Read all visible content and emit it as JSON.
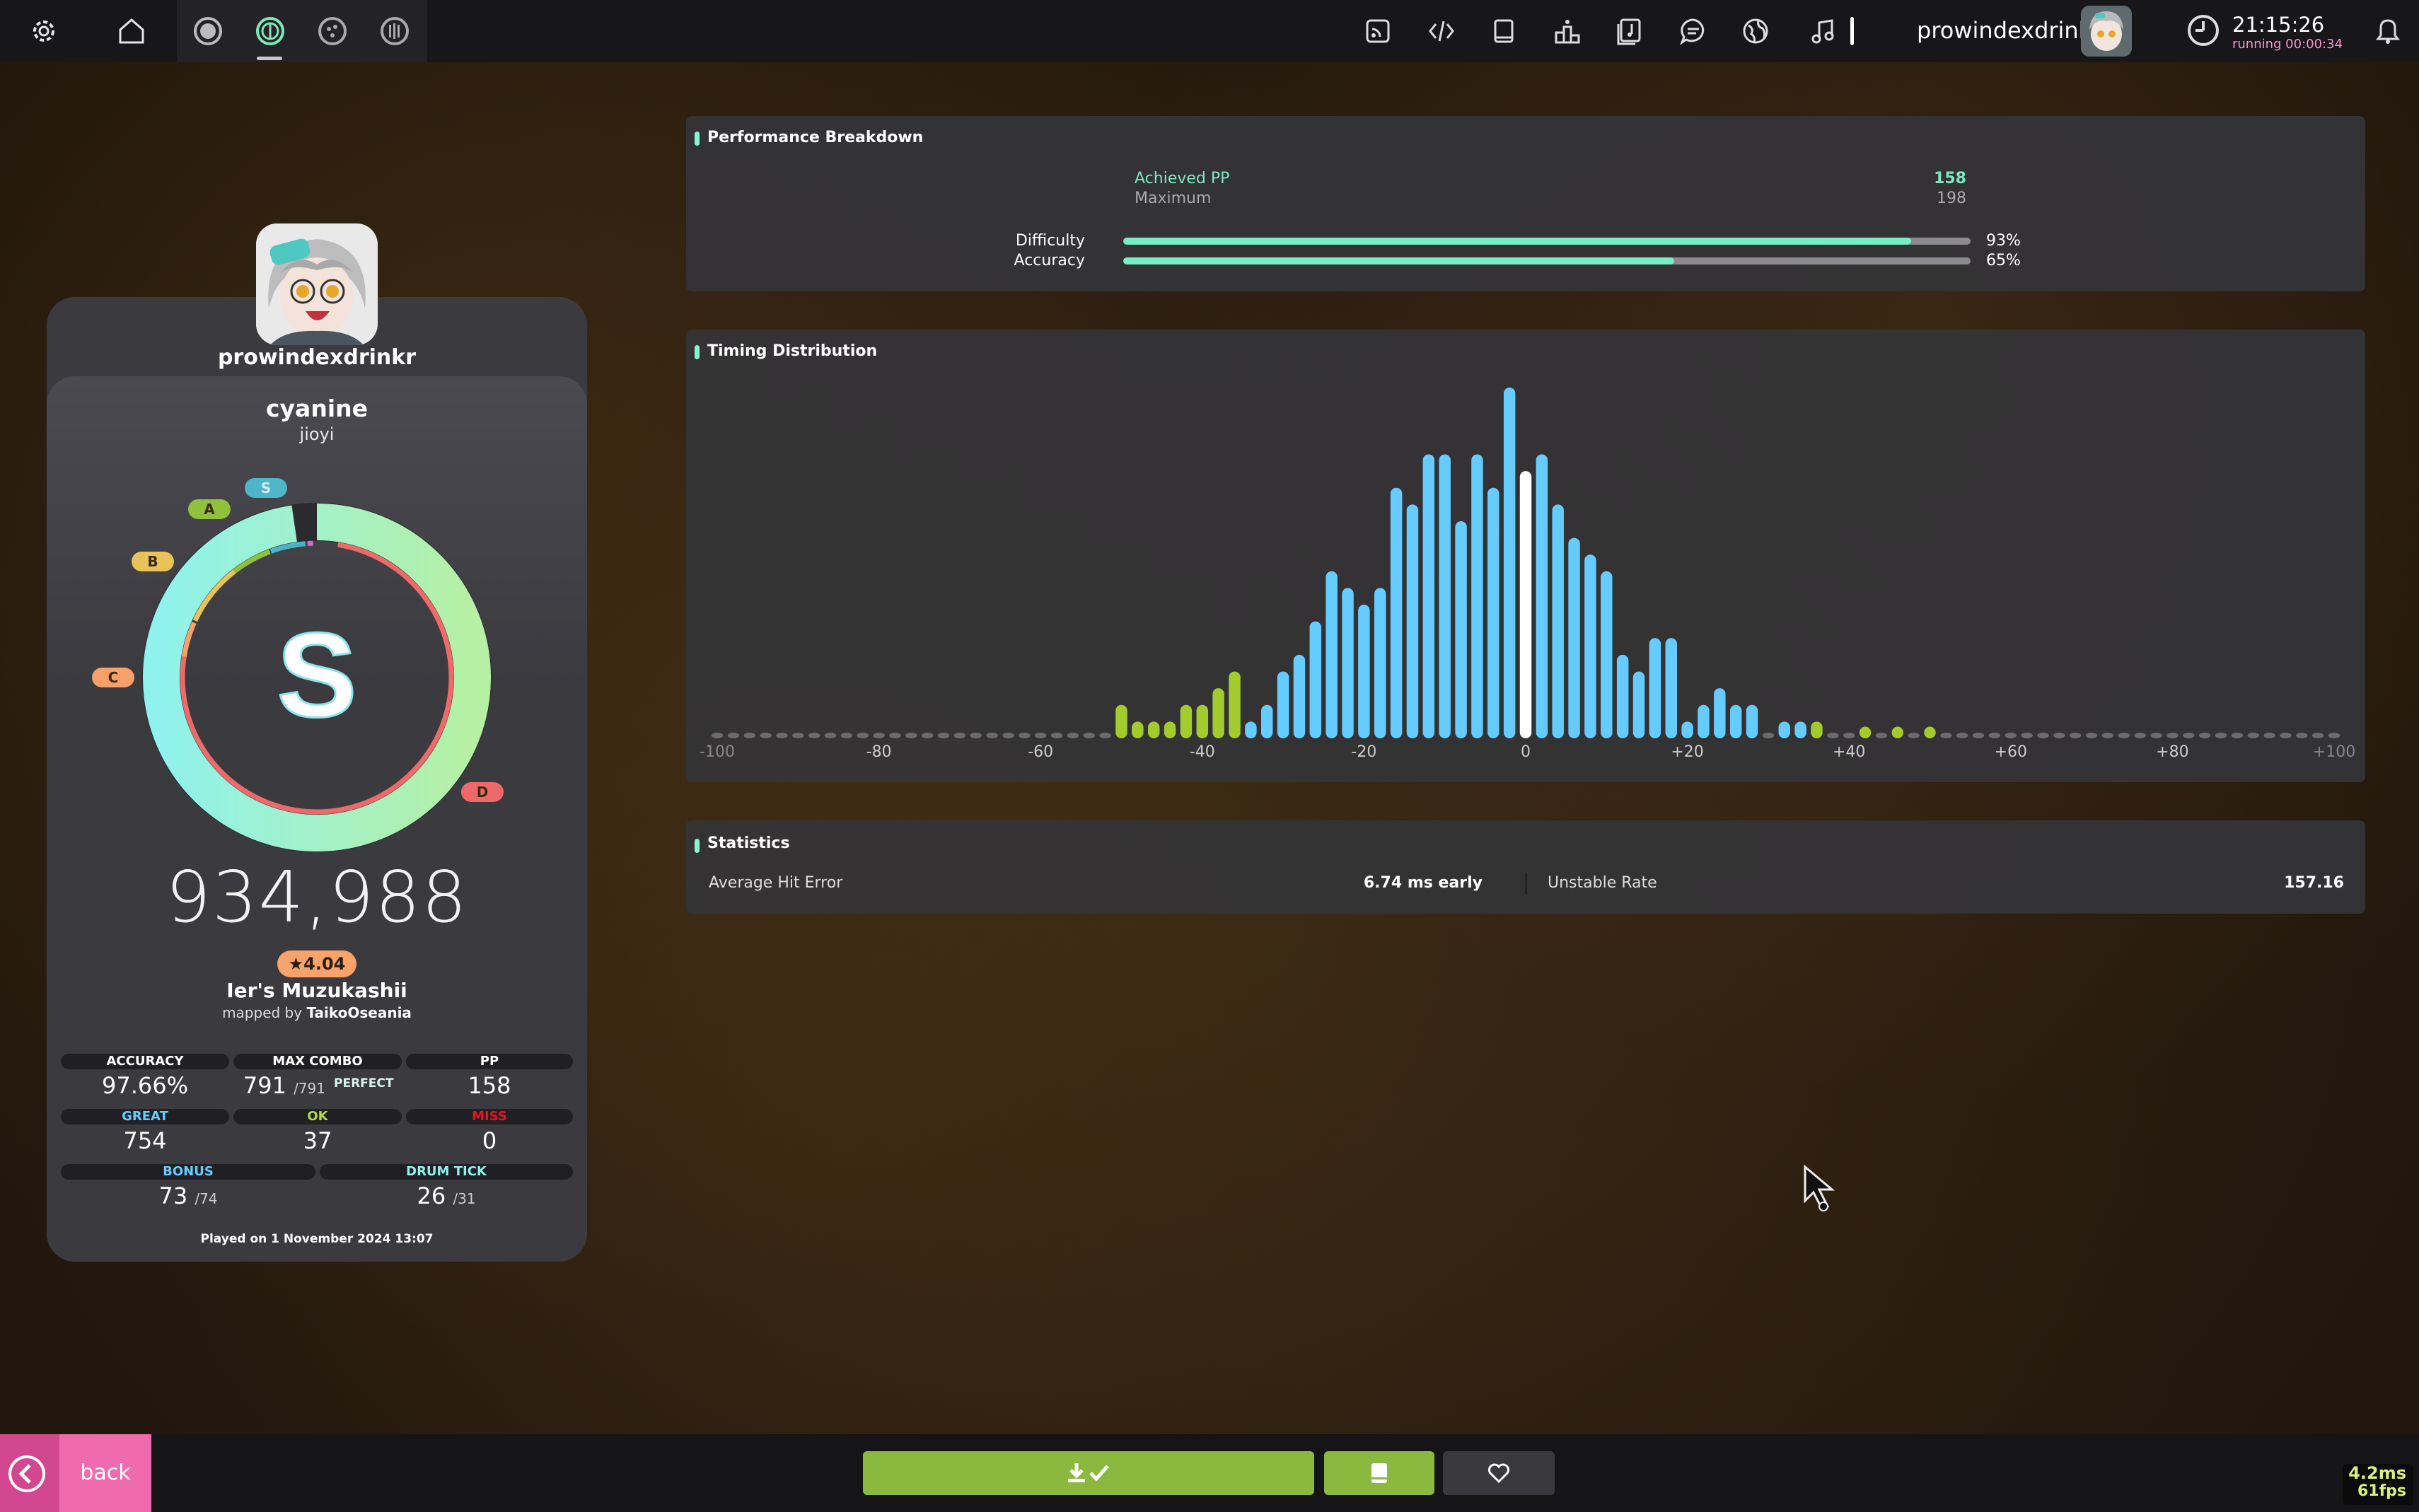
{
  "topbar": {
    "username": "prowindexdrinkr",
    "clock": "21:15:26",
    "running": "running 00:00:34",
    "icons": [
      "settings-icon",
      "home-icon",
      "osu-ruleset-icon",
      "taiko-ruleset-icon",
      "catch-ruleset-icon",
      "mania-ruleset-icon",
      "news-icon",
      "changelog-icon",
      "wiki-icon",
      "rankings-icon",
      "beatmap-listing-icon",
      "chat-icon",
      "dashboard-icon",
      "now-playing-icon",
      "notifications-icon"
    ]
  },
  "score_panel": {
    "player": "prowindexdrinkr",
    "beatmap_title": "cyanine",
    "beatmap_artist": "jioyi",
    "rank_labels": {
      "s": "S",
      "a": "A",
      "b": "B",
      "c": "C",
      "d": "D"
    },
    "grade": "S",
    "score": "934,988",
    "stars": "★4.04",
    "difficulty_name": "Ier's Muzukashii",
    "mapped_by": "mapped by",
    "mapper": "TaikoOseania",
    "accuracy_fraction": 0.9766,
    "stats": {
      "accuracy_label": "ACCURACY",
      "accuracy": "97.66%",
      "max_combo_label": "MAX COMBO",
      "max_combo": "791",
      "max_combo_total": "/791",
      "perfect": "PERFECT",
      "pp_label": "PP",
      "pp": "158",
      "great_label": "GREAT",
      "great": "754",
      "ok_label": "OK",
      "ok": "37",
      "miss_label": "MISS",
      "miss": "0",
      "bonus_label": "BONUS",
      "bonus": "73",
      "bonus_total": "/74",
      "drum_label": "DRUM TICK",
      "drum": "26",
      "drum_total": "/31"
    },
    "played_on": "Played on 1 November 2024 13:07"
  },
  "performance": {
    "title": "Performance Breakdown",
    "achieved_label": "Achieved PP",
    "achieved": "158",
    "maximum_label": "Maximum",
    "maximum": "198",
    "difficulty_label": "Difficulty",
    "difficulty_pct": "93%",
    "difficulty_value": 0.93,
    "accuracy_label": "Accuracy",
    "accuracy_pct": "65%",
    "accuracy_value": 0.65
  },
  "timing": {
    "title": "Timing Distribution"
  },
  "chart_data": {
    "type": "bar",
    "title": "Timing Distribution",
    "x_ticks": [
      "-100",
      "-80",
      "-60",
      "-40",
      "-20",
      "0",
      "+20",
      "+40",
      "+60",
      "+80",
      "+100"
    ],
    "xlim": [
      -100,
      100
    ],
    "bin_width": 2,
    "bins": [
      {
        "x": -50,
        "count": 2,
        "kind": "ok"
      },
      {
        "x": -48,
        "count": 1,
        "kind": "ok"
      },
      {
        "x": -46,
        "count": 1,
        "kind": "ok"
      },
      {
        "x": -44,
        "count": 1,
        "kind": "ok"
      },
      {
        "x": -42,
        "count": 2,
        "kind": "ok"
      },
      {
        "x": -40,
        "count": 2,
        "kind": "ok"
      },
      {
        "x": -38,
        "count": 3,
        "kind": "ok"
      },
      {
        "x": -36,
        "count": 4,
        "kind": "ok"
      },
      {
        "x": -34,
        "count": 1,
        "kind": "great"
      },
      {
        "x": -32,
        "count": 2,
        "kind": "great"
      },
      {
        "x": -30,
        "count": 4,
        "kind": "great"
      },
      {
        "x": -28,
        "count": 5,
        "kind": "great"
      },
      {
        "x": -26,
        "count": 7,
        "kind": "great"
      },
      {
        "x": -24,
        "count": 10,
        "kind": "great"
      },
      {
        "x": -22,
        "count": 9,
        "kind": "great"
      },
      {
        "x": -20,
        "count": 8,
        "kind": "great"
      },
      {
        "x": -18,
        "count": 9,
        "kind": "great"
      },
      {
        "x": -16,
        "count": 15,
        "kind": "great"
      },
      {
        "x": -14,
        "count": 14,
        "kind": "great"
      },
      {
        "x": -12,
        "count": 17,
        "kind": "great"
      },
      {
        "x": -10,
        "count": 17,
        "kind": "great"
      },
      {
        "x": -8,
        "count": 13,
        "kind": "great"
      },
      {
        "x": -6,
        "count": 17,
        "kind": "great"
      },
      {
        "x": -4,
        "count": 15,
        "kind": "great"
      },
      {
        "x": -2,
        "count": 21,
        "kind": "great"
      },
      {
        "x": 0,
        "count": 16,
        "kind": "perfect"
      },
      {
        "x": 2,
        "count": 17,
        "kind": "great"
      },
      {
        "x": 4,
        "count": 14,
        "kind": "great"
      },
      {
        "x": 6,
        "count": 12,
        "kind": "great"
      },
      {
        "x": 8,
        "count": 11,
        "kind": "great"
      },
      {
        "x": 10,
        "count": 10,
        "kind": "great"
      },
      {
        "x": 12,
        "count": 5,
        "kind": "great"
      },
      {
        "x": 14,
        "count": 4,
        "kind": "great"
      },
      {
        "x": 16,
        "count": 6,
        "kind": "great"
      },
      {
        "x": 18,
        "count": 6,
        "kind": "great"
      },
      {
        "x": 20,
        "count": 1,
        "kind": "great"
      },
      {
        "x": 22,
        "count": 2,
        "kind": "great"
      },
      {
        "x": 24,
        "count": 3,
        "kind": "great"
      },
      {
        "x": 26,
        "count": 2,
        "kind": "great"
      },
      {
        "x": 28,
        "count": 2,
        "kind": "great"
      },
      {
        "x": 32,
        "count": 1,
        "kind": "great"
      },
      {
        "x": 34,
        "count": 1,
        "kind": "great"
      },
      {
        "x": 36,
        "count": 1,
        "kind": "ok"
      },
      {
        "x": 42,
        "count": 0.5,
        "kind": "ok"
      },
      {
        "x": 46,
        "count": 0.5,
        "kind": "ok"
      },
      {
        "x": 50,
        "count": 0.5,
        "kind": "ok"
      }
    ],
    "colors": {
      "great": "#66ccff",
      "ok": "#a2cc2e",
      "perfect": "#ffffff",
      "empty": "#6b6b6f"
    }
  },
  "statistics": {
    "title": "Statistics",
    "avg_hit_error_label": "Average Hit Error",
    "avg_hit_error": "6.74 ms early",
    "unstable_rate_label": "Unstable Rate",
    "unstable_rate": "157.16"
  },
  "bottombar": {
    "back": "back",
    "frame_time": "4.2ms",
    "fps": "61fps"
  },
  "colors": {
    "accent_green": "#8bb83e",
    "mint": "#88f5cf",
    "pink": "#f06aaf"
  }
}
